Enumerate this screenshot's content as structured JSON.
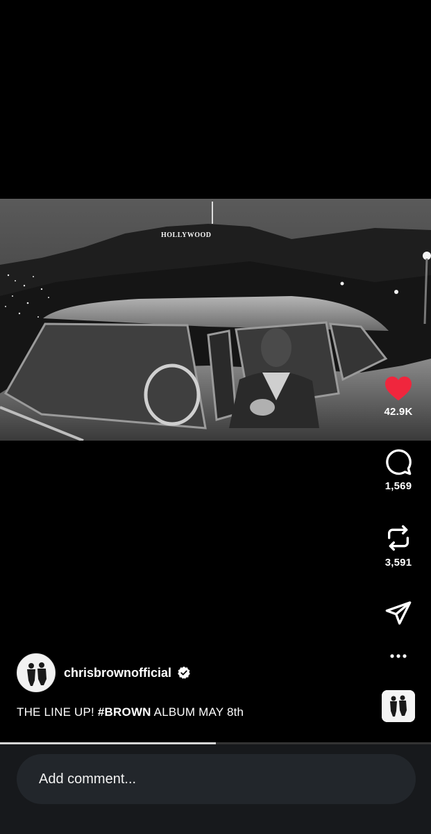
{
  "post": {
    "author": "chrisbrownofficial",
    "verified": true,
    "caption_pre": "THE LINE UP! ",
    "caption_tag": "#BROWN",
    "caption_post": " ALBUM MAY 8th",
    "media_sign_text": "HOLLYWOOD",
    "video_progress_percent": 50
  },
  "actions": {
    "like_count": "42.9K",
    "comment_count": "1,569",
    "repost_count": "3,591"
  },
  "comment": {
    "placeholder": "Add comment..."
  },
  "icons": {
    "like": "heart-filled-icon",
    "comment": "comment-bubble-icon",
    "repost": "repost-icon",
    "share": "send-icon",
    "more": "more-dots-icon",
    "verified": "verified-badge-icon"
  },
  "colors": {
    "like": "#f0263d",
    "background": "#000000",
    "comment_bar": "#17191c"
  }
}
